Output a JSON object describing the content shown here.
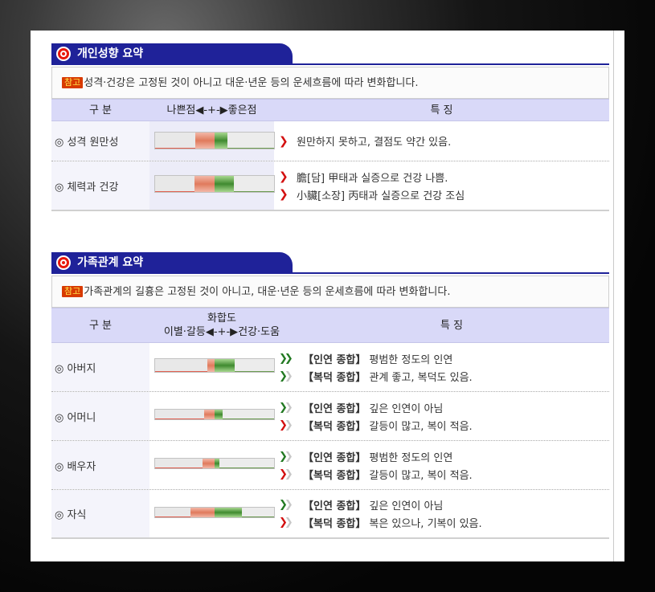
{
  "sec1": {
    "title": "개인성향 요약",
    "note_badge": "참고",
    "note": "성격·건강은 고정된 것이 아니고 대운·년운 등의 운세흐름에 따라 변화합니다.",
    "head": {
      "col1": "구 분",
      "col2": "나쁜점◀-+-▶좋은점",
      "col3": "특 징"
    },
    "rows": [
      {
        "label": "◎ 성격 원만성",
        "neg": 0.16,
        "pos": 0.11,
        "lines": [
          "원만하지 못하고, 결점도 약간 있음."
        ]
      },
      {
        "label": "◎ 체력과 건강",
        "neg": 0.17,
        "pos": 0.16,
        "lines": [
          "膽[담] 甲태과 실증으로 건강 나쁨.",
          "小臟[소장] 丙태과 실증으로 건강 조심"
        ]
      }
    ]
  },
  "sec2": {
    "title": "가족관계 요약",
    "note_badge": "참고",
    "note": "가족관계의 길흉은 고정된 것이 아니고, 대운·년운 등의 운세흐름에 따라 변화합니다.",
    "head": {
      "col1": "구 분",
      "col2a": "화합도",
      "col2b": "이별·갈등◀-+-▶건강·도움",
      "col3": "특 징"
    },
    "rows": [
      {
        "label": "◎ 아버지",
        "neg": 0.06,
        "pos": 0.17,
        "l1": {
          "tag": "【인연 종합】",
          "text": "평범한 정도의 인연",
          "arrow": "»",
          "color": "green"
        },
        "l2": {
          "tag": "【복덕 종합】",
          "text": "관계 좋고, 복덕도 있음.",
          "arrow": "›",
          "color": "green"
        }
      },
      {
        "label": "◎ 어머니",
        "neg": 0.09,
        "pos": 0.07,
        "l1": {
          "tag": "【인연 종합】",
          "text": "깊은 인연이 아님",
          "arrow": "›",
          "color": "green"
        },
        "l2": {
          "tag": "【복덕 종합】",
          "text": "갈등이 많고, 복이 적음.",
          "arrow": "›",
          "color": "red"
        }
      },
      {
        "label": "◎ 배우자",
        "neg": 0.1,
        "pos": 0.04,
        "l1": {
          "tag": "【인연 종합】",
          "text": "평범한 정도의 인연",
          "arrow": "›",
          "color": "green"
        },
        "l2": {
          "tag": "【복덕 종합】",
          "text": "갈등이 많고, 복이 적음.",
          "arrow": "›",
          "color": "red"
        }
      },
      {
        "label": "◎ 자식",
        "neg": 0.2,
        "pos": 0.23,
        "l1": {
          "tag": "【인연 종합】",
          "text": "깊은 인연이 아님",
          "arrow": "›",
          "color": "green"
        },
        "l2": {
          "tag": "【복덕 종합】",
          "text": "복은 있으나, 기복이 있음.",
          "arrow": "›",
          "color": "red"
        }
      }
    ]
  }
}
